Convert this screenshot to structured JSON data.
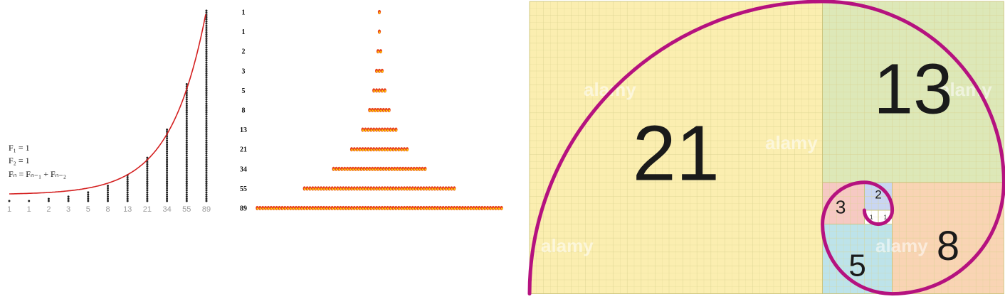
{
  "dot_chart": {
    "terms": [
      1,
      1,
      2,
      3,
      5,
      8,
      13,
      21,
      34,
      55,
      89
    ],
    "x_labels": [
      "1",
      "1",
      "2",
      "3",
      "5",
      "8",
      "13",
      "21",
      "34",
      "55",
      "89"
    ],
    "formula": {
      "line1": "F₁ = 1",
      "line2": "F₂ = 1",
      "line3": "Fₙ = Fₙ₋₁ + Fₙ₋₂"
    },
    "colors": {
      "dots": "#222222",
      "curve": "#d42020",
      "axis_labels": "#9a9a9a"
    }
  },
  "triangle_chart": {
    "rows": [
      1,
      1,
      2,
      3,
      5,
      8,
      13,
      21,
      34,
      55,
      89
    ],
    "row_labels": [
      "1",
      "1",
      "2",
      "3",
      "5",
      "8",
      "13",
      "21",
      "34",
      "55",
      "89"
    ],
    "colors": {
      "seed_outer": "#e8431c",
      "seed_inner": "#ffcc00",
      "label": "#111111"
    }
  },
  "spiral": {
    "squares": [
      {
        "label": "21",
        "value": 21,
        "color": "#fbeeb0"
      },
      {
        "label": "13",
        "value": 13,
        "color": "#dde8b8"
      },
      {
        "label": "8",
        "value": 8,
        "color": "#f9d4b4"
      },
      {
        "label": "5",
        "value": 5,
        "color": "#bde3ea"
      },
      {
        "label": "3",
        "value": 3,
        "color": "#f6c9c3"
      },
      {
        "label": "2",
        "value": 2,
        "color": "#c9d6f2"
      },
      {
        "label": "1",
        "value": 1,
        "color": "#ffffff"
      },
      {
        "label": "1",
        "value": 1,
        "color": "#ffffff"
      }
    ],
    "spiral_color": "#b5127f",
    "grid_color": "#d9d28f",
    "watermark": "alamy"
  }
}
